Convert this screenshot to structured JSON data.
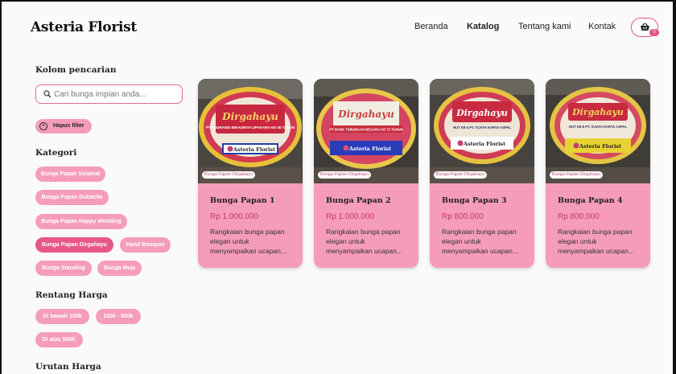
{
  "header": {
    "brand": "Asteria Florist",
    "nav": [
      {
        "label": "Beranda"
      },
      {
        "label": "Katalog"
      },
      {
        "label": "Tentang kami"
      },
      {
        "label": "Kontak"
      }
    ],
    "cart_count": "0",
    "accent_color": "#e05580"
  },
  "sidebar": {
    "search_heading": "Kolom pencarian",
    "search_placeholder": "Cari bunga impian anda...",
    "clear_filter": "Hapus filter",
    "category_heading": "Kategori",
    "categories": [
      {
        "label": "Bunga Papan Selamat",
        "active": false
      },
      {
        "label": "Bunga Papan Dukacita",
        "active": false
      },
      {
        "label": "Bunga Papan Happy Wedding",
        "active": false
      },
      {
        "label": "Bunga Papan Dirgahayu",
        "active": true
      },
      {
        "label": "Hand Bouquet",
        "active": false
      },
      {
        "label": "Bunga Standing",
        "active": false
      },
      {
        "label": "Bunga Meja",
        "active": false
      }
    ],
    "price_heading": "Rentang Harga",
    "price_ranges": [
      {
        "label": "Di bawah 100k"
      },
      {
        "label": "100k - 500k"
      },
      {
        "label": "Di atas 500K"
      }
    ],
    "sort_heading": "Urutan Harga"
  },
  "products": [
    {
      "tag": "Bunga Papan Dirgahayu",
      "title": "Bunga Papan 1",
      "price": "Rp 1.000.000",
      "desc": "Rangkaian bunga papan elegan untuk menyampaikan ucapan...",
      "board_title": "Dirgahayu",
      "board_sub": "PT ASURANSI BINAGRIYA UPAKARA KE-35 TAHUN",
      "board_logo": "Asteria Florist"
    },
    {
      "tag": "Bunga Papan Dirgahayu",
      "title": "Bunga Papan 2",
      "price": "Rp 1.000.000",
      "desc": "Rangkaian bunga papan elegan untuk menyampaikan ucapan...",
      "board_title": "Dirgahayu",
      "board_sub": "PT BANK TABUNGAN NEGARA KE-73 TAHUN",
      "board_logo": "Asteria Florist"
    },
    {
      "tag": "Bunga Papan Dirgahayu",
      "title": "Bunga Papan 3",
      "price": "Rp 800.000",
      "desc": "Rangkaian bunga papan elegan untuk menyampaikan ucapan...",
      "board_title": "Dirgahayu",
      "board_sub": "HUT KE-4 PT. VIJAYA KARYA ASPAL",
      "board_logo": "Asteria Florist"
    },
    {
      "tag": "Bunga Papan Dirgahayu",
      "title": "Bunga Papan 4",
      "price": "Rp 800.000",
      "desc": "Rangkaian bunga papan elegan untuk menyampaikan ucapan...",
      "board_title": "Dirgahayu",
      "board_sub": "HUT KE-6 PT. VIJAYA KARYA ASPAL",
      "board_logo": "Asteria Florist"
    }
  ]
}
